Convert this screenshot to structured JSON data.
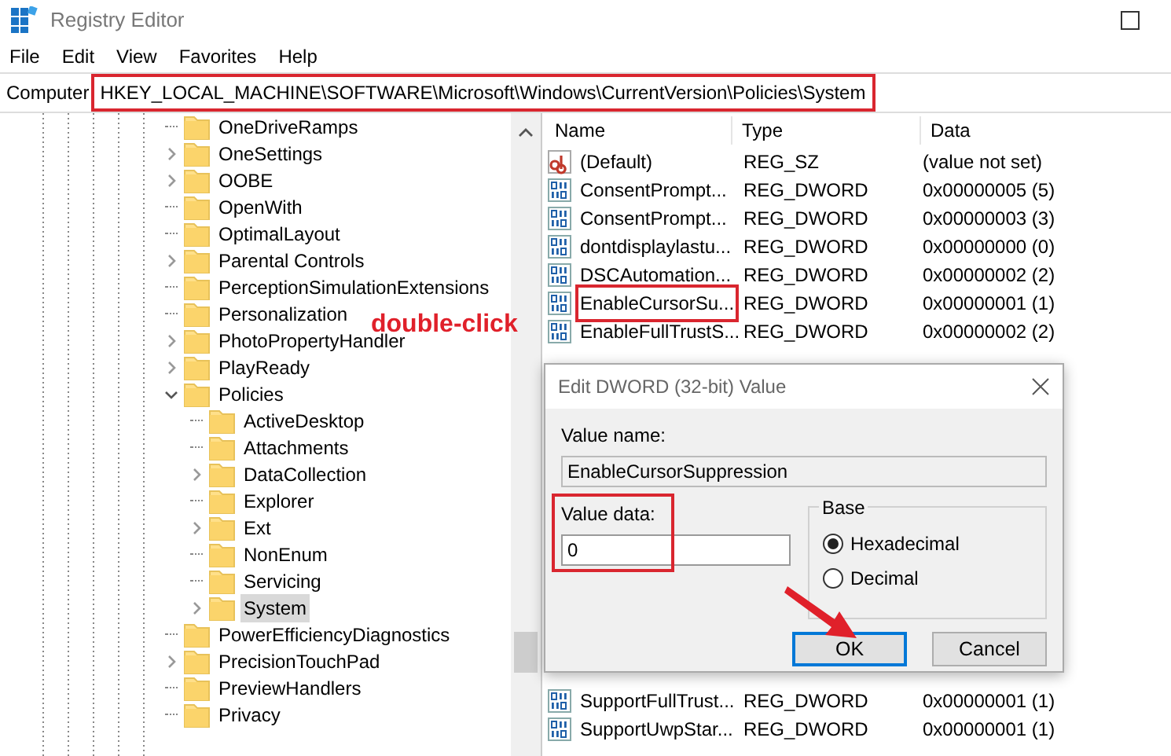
{
  "window": {
    "title": "Registry Editor"
  },
  "menu": [
    {
      "label": "File"
    },
    {
      "label": "Edit"
    },
    {
      "label": "View"
    },
    {
      "label": "Favorites"
    },
    {
      "label": "Help"
    }
  ],
  "address": {
    "label": "Computer",
    "path": "HKEY_LOCAL_MACHINE\\SOFTWARE\\Microsoft\\Windows\\CurrentVersion\\Policies\\System",
    "highlighted": true
  },
  "tree": {
    "items": [
      {
        "label": "OneDriveRamps",
        "kind": "leaf",
        "selected": false
      },
      {
        "label": "OneSettings",
        "kind": "collapsed",
        "selected": false
      },
      {
        "label": "OOBE",
        "kind": "collapsed",
        "selected": false
      },
      {
        "label": "OpenWith",
        "kind": "leaf",
        "selected": false
      },
      {
        "label": "OptimalLayout",
        "kind": "leaf",
        "selected": false
      },
      {
        "label": "Parental Controls",
        "kind": "collapsed",
        "selected": false
      },
      {
        "label": "PerceptionSimulationExtensions",
        "kind": "leaf",
        "selected": false
      },
      {
        "label": "Personalization",
        "kind": "leaf",
        "selected": false
      },
      {
        "label": "PhotoPropertyHandler",
        "kind": "collapsed",
        "selected": false
      },
      {
        "label": "PlayReady",
        "kind": "collapsed",
        "selected": false
      },
      {
        "label": "Policies",
        "kind": "expanded",
        "selected": false,
        "children": [
          {
            "label": "ActiveDesktop",
            "kind": "leaf",
            "selected": false
          },
          {
            "label": "Attachments",
            "kind": "leaf",
            "selected": false
          },
          {
            "label": "DataCollection",
            "kind": "collapsed",
            "selected": false
          },
          {
            "label": "Explorer",
            "kind": "leaf",
            "selected": false
          },
          {
            "label": "Ext",
            "kind": "collapsed",
            "selected": false
          },
          {
            "label": "NonEnum",
            "kind": "leaf",
            "selected": false
          },
          {
            "label": "Servicing",
            "kind": "leaf",
            "selected": false
          },
          {
            "label": "System",
            "kind": "collapsed",
            "selected": true
          }
        ]
      },
      {
        "label": "PowerEfficiencyDiagnostics",
        "kind": "leaf",
        "selected": false
      },
      {
        "label": "PrecisionTouchPad",
        "kind": "collapsed",
        "selected": false
      },
      {
        "label": "PreviewHandlers",
        "kind": "leaf",
        "selected": false
      },
      {
        "label": "Privacy",
        "kind": "leaf",
        "selected": false
      }
    ]
  },
  "values": {
    "columns": [
      "Name",
      "Type",
      "Data"
    ],
    "rows": [
      {
        "kind": "string",
        "name": "(Default)",
        "type": "REG_SZ",
        "data": "(value not set)",
        "highlighted": false
      },
      {
        "kind": "binary",
        "name": "ConsentPrompt...",
        "type": "REG_DWORD",
        "data": "0x00000005 (5)",
        "highlighted": false
      },
      {
        "kind": "binary",
        "name": "ConsentPrompt...",
        "type": "REG_DWORD",
        "data": "0x00000003 (3)",
        "highlighted": false
      },
      {
        "kind": "binary",
        "name": "dontdisplaylastu...",
        "type": "REG_DWORD",
        "data": "0x00000000 (0)",
        "highlighted": false
      },
      {
        "kind": "binary",
        "name": "DSCAutomation...",
        "type": "REG_DWORD",
        "data": "0x00000002 (2)",
        "highlighted": false
      },
      {
        "kind": "binary",
        "name": "EnableCursorSu...",
        "type": "REG_DWORD",
        "data": "0x00000001 (1)",
        "highlighted": true
      },
      {
        "kind": "binary",
        "name": "EnableFullTrustS...",
        "type": "REG_DWORD",
        "data": "0x00000002 (2)",
        "highlighted": false
      }
    ],
    "bottom_rows": [
      {
        "kind": "binary",
        "name": "SupportFullTrust...",
        "type": "REG_DWORD",
        "data": "0x00000001 (1)",
        "highlighted": false
      },
      {
        "kind": "binary",
        "name": "SupportUwpStar...",
        "type": "REG_DWORD",
        "data": "0x00000001 (1)",
        "highlighted": false
      }
    ]
  },
  "annotation": {
    "label": "double-click"
  },
  "dialog": {
    "title": "Edit DWORD (32-bit) Value",
    "value_name_label": "Value name:",
    "value_name": "EnableCursorSuppression",
    "value_data_label": "Value data:",
    "value_data": "0",
    "value_data_highlighted": true,
    "base_label": "Base",
    "bases": [
      {
        "label": "Hexadecimal",
        "selected": true
      },
      {
        "label": "Decimal",
        "selected": false
      }
    ],
    "buttons": [
      {
        "label": "OK",
        "default": true
      },
      {
        "label": "Cancel",
        "default": false
      }
    ],
    "arrow_to_ok": true
  }
}
